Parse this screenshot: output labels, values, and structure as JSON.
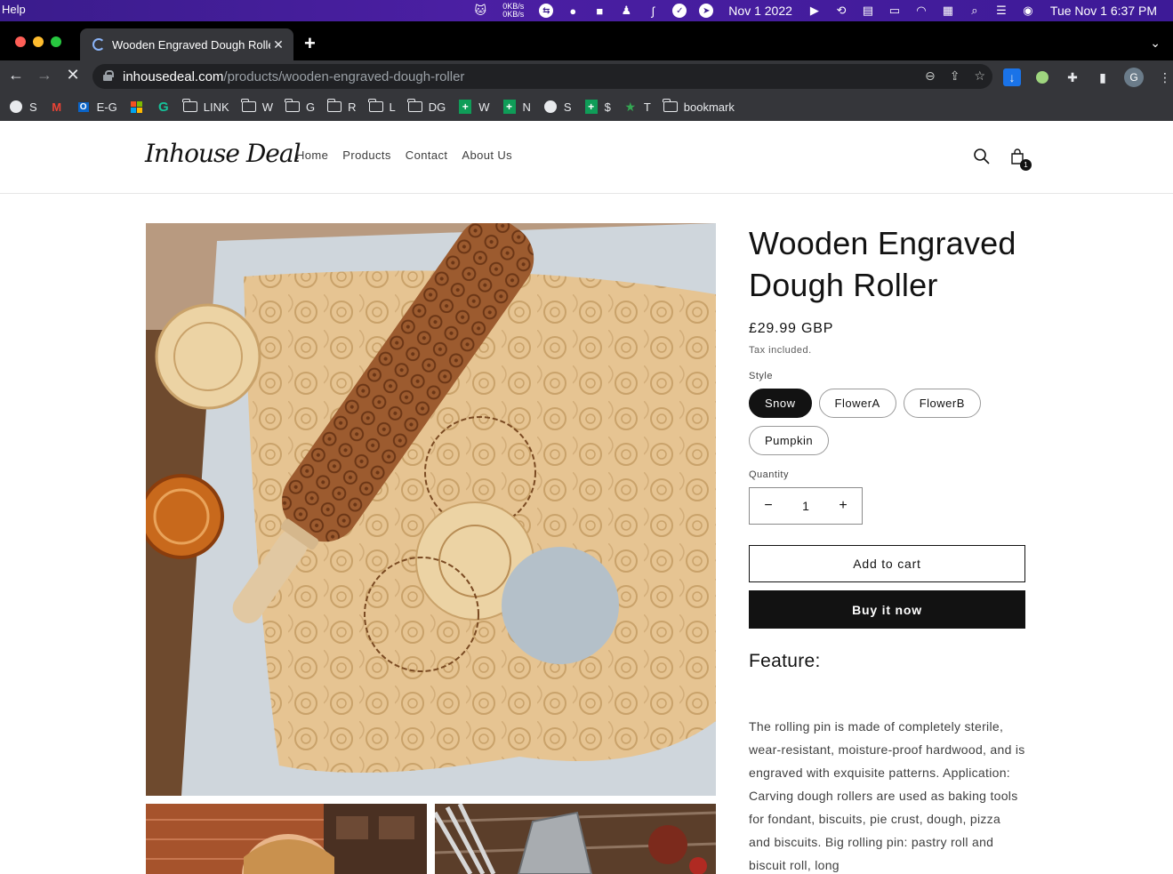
{
  "menubar": {
    "app_menu": "Help",
    "net_up": "0KB/s",
    "net_down": "0KB/s",
    "date_short": "Nov 1 2022",
    "clock": "Tue Nov 1  6:37 PM"
  },
  "browser": {
    "tab_title": "Wooden Engraved Dough Roller",
    "url_host": "inhousedeal.com",
    "url_path": "/products/wooden-engraved-dough-roller",
    "profile_initial": "G",
    "bookmarks": [
      {
        "label": "S",
        "icon": "globe-icon"
      },
      {
        "label": "",
        "icon": "gmail-icon"
      },
      {
        "label": "E-G",
        "icon": "outlook-icon"
      },
      {
        "label": "",
        "icon": "microsoft-icon"
      },
      {
        "label": "",
        "icon": "grammarly-icon"
      },
      {
        "label": "LINK",
        "icon": "folder-icon"
      },
      {
        "label": "W",
        "icon": "folder-icon"
      },
      {
        "label": "G",
        "icon": "folder-icon"
      },
      {
        "label": "R",
        "icon": "folder-icon"
      },
      {
        "label": "L",
        "icon": "folder-icon"
      },
      {
        "label": "DG",
        "icon": "folder-icon"
      },
      {
        "label": "W",
        "icon": "sheets-icon"
      },
      {
        "label": "N",
        "icon": "sheets-icon"
      },
      {
        "label": "S",
        "icon": "globe-icon"
      },
      {
        "label": "$",
        "icon": "sheets-icon"
      },
      {
        "label": "T",
        "icon": "star-icon"
      },
      {
        "label": "bookmark",
        "icon": "folder-icon"
      }
    ]
  },
  "store": {
    "logo": "Inhouse Deal",
    "nav": [
      "Home",
      "Products",
      "Contact",
      "About Us"
    ],
    "cart_count": "1"
  },
  "product": {
    "title": "Wooden Engraved Dough Roller",
    "price": "£29.99 GBP",
    "tax_note": "Tax included.",
    "style_label": "Style",
    "styles": [
      "Snow",
      "FlowerA",
      "FlowerB",
      "Pumpkin"
    ],
    "selected_style": "Snow",
    "quantity_label": "Quantity",
    "quantity": "1",
    "add_to_cart": "Add to cart",
    "buy_now": "Buy it now",
    "feature_heading": "Feature:",
    "description": "The rolling pin is made of completely sterile, wear-resistant, moisture-proof hardwood, and is engraved with exquisite patterns. Application: Carving dough rollers are used as baking tools for fondant, biscuits, pie crust, dough, pizza and biscuits. Big rolling pin: pastry roll and biscuit roll, long"
  },
  "colors": {
    "accent_dark": "#121212",
    "menubar": "#3a1c8c",
    "chrome_toolbar": "#35363a"
  }
}
